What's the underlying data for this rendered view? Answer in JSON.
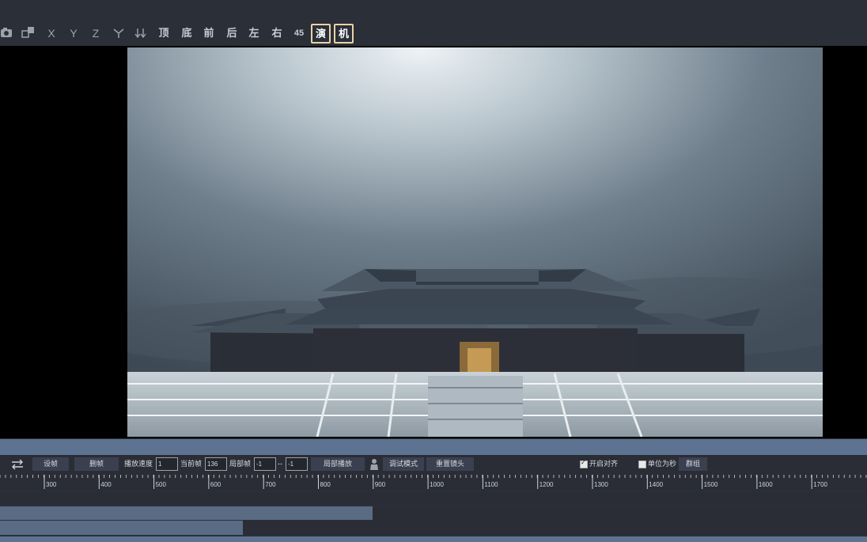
{
  "toolbar": {
    "axis_x": "X",
    "axis_y": "Y",
    "axis_z": "Z",
    "top": "顶",
    "bottom": "底",
    "front": "前",
    "back": "后",
    "left": "左",
    "right": "右",
    "angle45": "45",
    "perform": "演",
    "camera": "机"
  },
  "controls": {
    "set_frame": "设帧",
    "delete_frame": "删帧",
    "play_speed_label": "播放速度",
    "play_speed_value": "1",
    "current_frame_label": "当前帧",
    "current_frame_value": "136",
    "local_frame_label": "局部帧",
    "local_start": "-1",
    "range_sep": "--",
    "local_end": "-1",
    "local_play": "局部播放",
    "debug_mode": "调试模式",
    "reset_camera": "重置镜头",
    "align_label": "开启对齐",
    "align_checked": true,
    "unit_seconds_label": "单位为秒",
    "unit_seconds_checked": false,
    "group": "群组"
  },
  "ruler": {
    "labels": [
      "300",
      "400",
      "500",
      "600",
      "700",
      "800",
      "900",
      "1000",
      "1100",
      "1200",
      "1300",
      "1400",
      "1500",
      "1600",
      "1700"
    ]
  },
  "tracks": {
    "track1_progress": 0.43,
    "track2_progress": 0.28
  },
  "colors": {
    "accent_border": "#e8d3a8",
    "timeline_bar": "#5d7391"
  }
}
